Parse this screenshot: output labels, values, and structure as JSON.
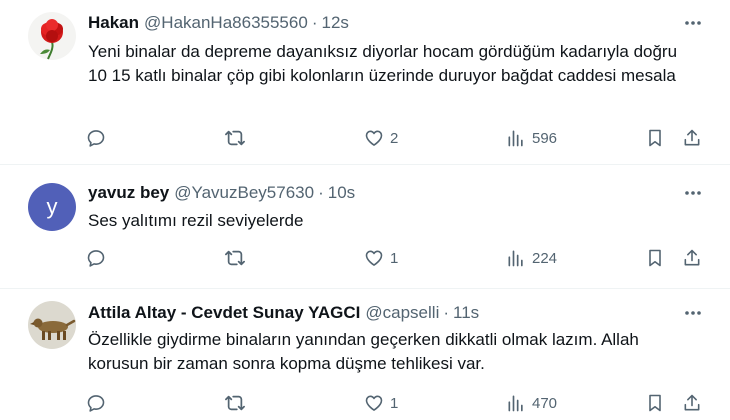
{
  "tweets": [
    {
      "name": "Hakan",
      "handle": "@HakanHa86355560",
      "separator": "·",
      "time": "12s",
      "text": "Yeni binalar da depreme dayanıksız diyorlar hocam gördüğüm kadarıyla doğru 10 15 katlı binalar çöp gibi kolonların  üzerinde duruyor bağdat caddesi mesala",
      "likes": "2",
      "views": "596",
      "avatar_icon": "rose-icon"
    },
    {
      "name": "yavuz bey",
      "handle": "@YavuzBey57630",
      "separator": "·",
      "time": "10s",
      "text": "Ses yalıtımı rezil seviyelerde",
      "likes": "1",
      "views": "224",
      "avatar_letter": "y",
      "avatar_color": "#5160b8"
    },
    {
      "name": "Attila Altay - Cevdet Sunay YAGCI",
      "handle": "@capselli",
      "separator": "·",
      "time": "11s",
      "text": "Özellikle giydirme binaların yanından geçerken dikkatli olmak lazım. Allah korusun bir zaman sonra kopma düşme tehlikesi var.",
      "likes": "1",
      "views": "470",
      "avatar_icon": "animal-figurine-icon"
    }
  ],
  "colors": {
    "text_primary": "#0f1419",
    "text_secondary": "#536471",
    "divider": "#eff3f4"
  }
}
